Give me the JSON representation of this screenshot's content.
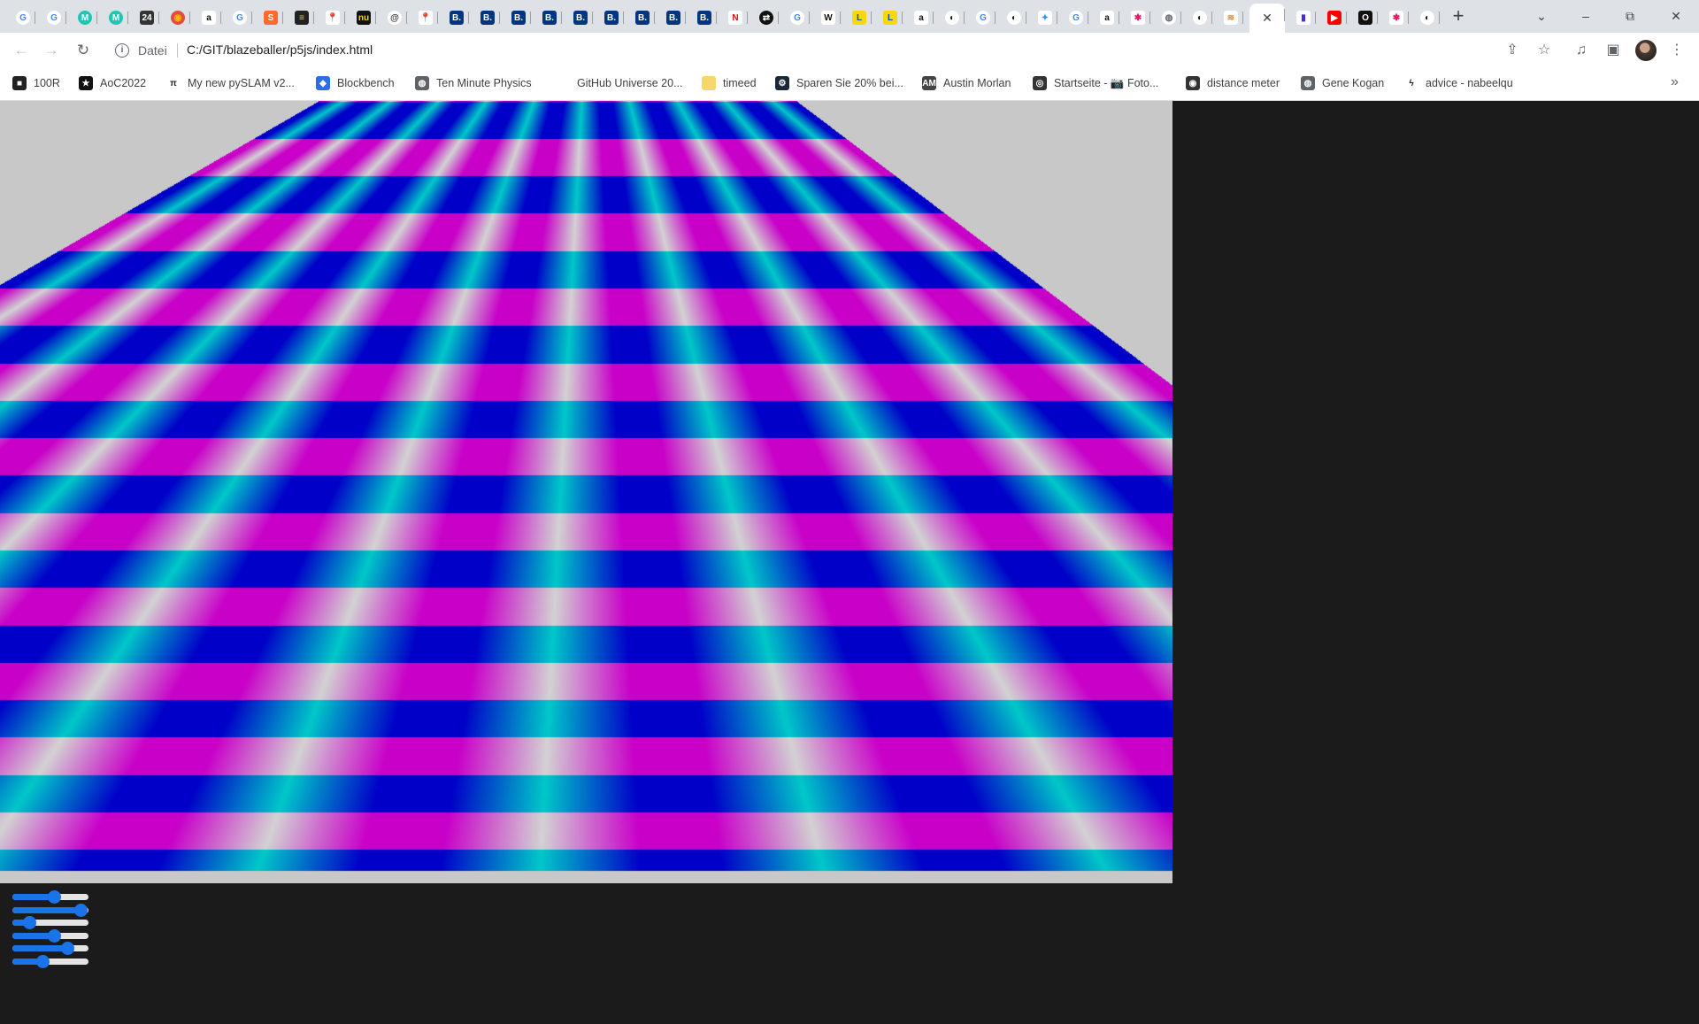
{
  "browser": {
    "tabs": [
      {
        "icon": "google-icon",
        "glyph": "G",
        "color": "#ffffff",
        "fg": "#4285f4",
        "round": true
      },
      {
        "icon": "google-icon",
        "glyph": "G",
        "color": "#ffffff",
        "fg": "#4285f4",
        "round": true
      },
      {
        "icon": "mural-icon",
        "glyph": "M",
        "color": "#1cc7b3",
        "fg": "#ffffff",
        "round": true
      },
      {
        "icon": "mural-icon",
        "glyph": "M",
        "color": "#1cc7b3",
        "fg": "#ffffff",
        "round": true
      },
      {
        "icon": "calendar-icon",
        "glyph": "24",
        "color": "#333333",
        "fg": "#ffffff",
        "round": false
      },
      {
        "icon": "chrome-colorful-icon",
        "glyph": "◉",
        "color": "#e44d3a",
        "fg": "#fbbc05",
        "round": true
      },
      {
        "icon": "amazon-icon",
        "glyph": "a",
        "color": "#ffffff",
        "fg": "#111111",
        "round": false
      },
      {
        "icon": "google-icon",
        "glyph": "G",
        "color": "#ffffff",
        "fg": "#4285f4",
        "round": true
      },
      {
        "icon": "ssh-icon",
        "glyph": "S",
        "color": "#ff6a2b",
        "fg": "#ffffff",
        "round": false
      },
      {
        "icon": "notebook-icon",
        "glyph": "≡",
        "color": "#222222",
        "fg": "#f5d000",
        "round": false
      },
      {
        "icon": "maps-pin-icon",
        "glyph": "📍",
        "color": "#ffffff",
        "fg": "#34a853",
        "round": false
      },
      {
        "icon": "nu-icon",
        "glyph": "nu",
        "color": "#111111",
        "fg": "#f5d000",
        "round": false
      },
      {
        "icon": "at-icon",
        "glyph": "@",
        "color": "#ffffff",
        "fg": "#333333",
        "round": true
      },
      {
        "icon": "maps-pin-icon",
        "glyph": "📍",
        "color": "#ffffff",
        "fg": "#34a853",
        "round": false
      },
      {
        "icon": "booking-icon",
        "glyph": "B.",
        "color": "#003580",
        "fg": "#ffffff",
        "round": false
      },
      {
        "icon": "booking-icon",
        "glyph": "B.",
        "color": "#003580",
        "fg": "#ffffff",
        "round": false
      },
      {
        "icon": "booking-icon",
        "glyph": "B.",
        "color": "#003580",
        "fg": "#ffffff",
        "round": false
      },
      {
        "icon": "booking-icon",
        "glyph": "B.",
        "color": "#003580",
        "fg": "#ffffff",
        "round": false
      },
      {
        "icon": "booking-icon",
        "glyph": "B.",
        "color": "#003580",
        "fg": "#ffffff",
        "round": false
      },
      {
        "icon": "booking-icon",
        "glyph": "B.",
        "color": "#003580",
        "fg": "#ffffff",
        "round": false
      },
      {
        "icon": "booking-icon",
        "glyph": "B.",
        "color": "#003580",
        "fg": "#ffffff",
        "round": false
      },
      {
        "icon": "booking-icon",
        "glyph": "B.",
        "color": "#003580",
        "fg": "#ffffff",
        "round": false
      },
      {
        "icon": "booking-icon",
        "glyph": "B.",
        "color": "#003580",
        "fg": "#ffffff",
        "round": false
      },
      {
        "icon": "netflix-icon",
        "glyph": "N",
        "color": "#ffffff",
        "fg": "#e50914",
        "round": false
      },
      {
        "icon": "arrows-icon",
        "glyph": "⇄",
        "color": "#111111",
        "fg": "#ffffff",
        "round": true
      },
      {
        "icon": "google-icon",
        "glyph": "G",
        "color": "#ffffff",
        "fg": "#4285f4",
        "round": true
      },
      {
        "icon": "wikipedia-icon",
        "glyph": "W",
        "color": "#ffffff",
        "fg": "#111111",
        "round": false
      },
      {
        "icon": "lidl-icon",
        "glyph": "L",
        "color": "#f8d80b",
        "fg": "#0050aa",
        "round": false
      },
      {
        "icon": "lidl-icon",
        "glyph": "L",
        "color": "#f8d80b",
        "fg": "#0050aa",
        "round": false
      },
      {
        "icon": "amazon-icon",
        "glyph": "a",
        "color": "#ffffff",
        "fg": "#111111",
        "round": false
      },
      {
        "icon": "github-icon",
        "glyph": "◐",
        "color": "#ffffff",
        "fg": "#111111",
        "round": true
      },
      {
        "icon": "google-icon",
        "glyph": "G",
        "color": "#ffffff",
        "fg": "#4285f4",
        "round": true
      },
      {
        "icon": "github-icon",
        "glyph": "◐",
        "color": "#ffffff",
        "fg": "#111111",
        "round": true
      },
      {
        "icon": "twitter-icon",
        "glyph": "✦",
        "color": "#ffffff",
        "fg": "#1d9bf0",
        "round": false
      },
      {
        "icon": "google-icon",
        "glyph": "G",
        "color": "#ffffff",
        "fg": "#4285f4",
        "round": true
      },
      {
        "icon": "amazon-icon",
        "glyph": "a",
        "color": "#ffffff",
        "fg": "#111111",
        "round": false
      },
      {
        "icon": "asterisk-icon",
        "glyph": "✱",
        "color": "#ffffff",
        "fg": "#e5195f",
        "round": false
      },
      {
        "icon": "globe-icon",
        "glyph": "◍",
        "color": "#ffffff",
        "fg": "#5f6368",
        "round": true
      },
      {
        "icon": "github-icon",
        "glyph": "◐",
        "color": "#ffffff",
        "fg": "#111111",
        "round": true
      },
      {
        "icon": "stackoverflow-icon",
        "glyph": "≋",
        "color": "#ffffff",
        "fg": "#f48024",
        "round": false
      },
      {
        "icon": "close-icon",
        "glyph": "✕",
        "color": "#ffffff",
        "fg": "#3c4043",
        "round": false,
        "active": true
      },
      {
        "icon": "shield-icon",
        "glyph": "▮",
        "color": "#ffffff",
        "fg": "#4a2bd6",
        "round": false
      },
      {
        "icon": "youtube-icon",
        "glyph": "▶",
        "color": "#ff0000",
        "fg": "#ffffff",
        "round": false
      },
      {
        "icon": "opera-icon",
        "glyph": "O",
        "color": "#111111",
        "fg": "#ffffff",
        "round": false
      },
      {
        "icon": "asterisk-icon",
        "glyph": "✱",
        "color": "#ffffff",
        "fg": "#e5195f",
        "round": false
      },
      {
        "icon": "github-icon",
        "glyph": "◐",
        "color": "#ffffff",
        "fg": "#111111",
        "round": true
      }
    ],
    "new_tab_label": "+",
    "tab_search_glyph": "⌄",
    "window": {
      "minimize": "–",
      "restore": "⧉",
      "close": "✕"
    },
    "nav": {
      "back": "←",
      "forward": "→",
      "reload": "↻"
    },
    "address": {
      "info": "i",
      "scheme_label": "Datei",
      "url": "C:/GIT/blazeballer/p5js/index.html"
    },
    "toolbar_icons": {
      "share": "⇪",
      "bookmark_star": "☆",
      "media": "♫",
      "side_panel": "▣",
      "menu": "⋮"
    },
    "bookmarks": [
      {
        "label": "100R",
        "icon": "square-icon",
        "color": "#222222",
        "glyph": "■"
      },
      {
        "label": "AoC2022",
        "icon": "star-icon",
        "color": "#111111",
        "glyph": "★"
      },
      {
        "label": "My new pySLAM v2...",
        "icon": "pi-icon",
        "color": "#ffffff",
        "glyph": "π"
      },
      {
        "label": "Blockbench",
        "icon": "blockbench-icon",
        "color": "#2b6ee6",
        "glyph": "◆"
      },
      {
        "label": "Ten Minute Physics",
        "icon": "globe-icon",
        "color": "#5f6368",
        "glyph": "◍"
      },
      {
        "label": "GitHub Universe 20...",
        "icon": "blank-icon",
        "color": "#ffffff",
        "glyph": ""
      },
      {
        "label": "timeed",
        "icon": "folder-icon",
        "color": "#f6d76b",
        "glyph": ""
      },
      {
        "label": "Sparen Sie 20% bei...",
        "icon": "steam-icon",
        "color": "#1b2838",
        "glyph": "⚙"
      },
      {
        "label": "Austin Morlan",
        "icon": "am-icon",
        "color": "#444444",
        "glyph": "AM"
      },
      {
        "label": "Startseite - 📷 Foto...",
        "icon": "spiral-icon",
        "color": "#333333",
        "glyph": "◎"
      },
      {
        "label": "distance meter",
        "icon": "eye-icon",
        "color": "#333333",
        "glyph": "◉"
      },
      {
        "label": "Gene Kogan",
        "icon": "globe-icon",
        "color": "#5f6368",
        "glyph": "◍"
      },
      {
        "label": "advice - nabeelqu",
        "icon": "bolt-icon",
        "color": "#ffffff",
        "glyph": "ϟ"
      }
    ],
    "bookmarks_overflow": "»"
  },
  "sketch": {
    "background": "#c8c8c8",
    "colors": {
      "magenta": "#c800c8",
      "blue": "#0000c8",
      "cyan": "#00c8c8",
      "light": "#d2d2d2"
    },
    "checker_columns": 20,
    "checker_rows": 24
  },
  "sliders": [
    {
      "name": "slider-1",
      "value": 0.55
    },
    {
      "name": "slider-2",
      "value": 0.9
    },
    {
      "name": "slider-3",
      "value": 0.22
    },
    {
      "name": "slider-4",
      "value": 0.55
    },
    {
      "name": "slider-5",
      "value": 0.72
    },
    {
      "name": "slider-6",
      "value": 0.4
    }
  ]
}
